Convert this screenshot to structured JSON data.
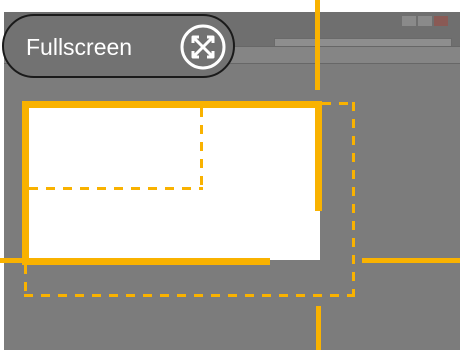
{
  "fullscreen_button": {
    "label": "Fullscreen",
    "icon": "fullscreen-expand-icon"
  },
  "colors": {
    "guide": "#f9b200",
    "overlay": "#7c7c7c",
    "pill_background": "#727272",
    "pill_border": "#1a1a1a",
    "text": "#ffffff"
  }
}
